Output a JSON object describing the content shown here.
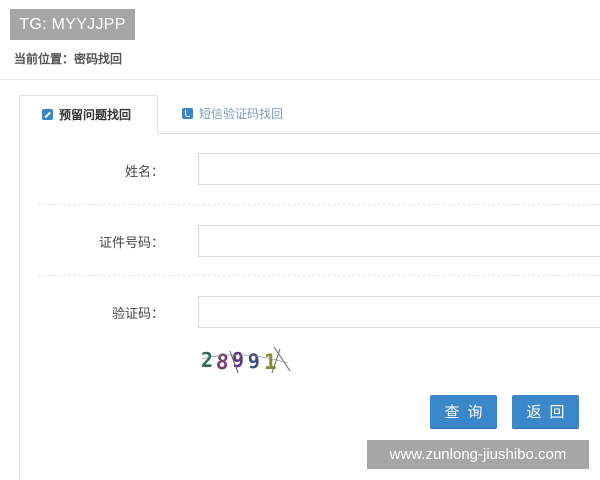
{
  "overlay": {
    "tg_label": "TG: MYYJJPP",
    "watermark_url": "www.zunlong-jiushibo.com"
  },
  "breadcrumb": {
    "text": "当前位置：密码找回"
  },
  "tabs": [
    {
      "label": "预留问题找回",
      "icon": "pencil-icon",
      "active": true
    },
    {
      "label": "短信验证码找回",
      "icon": "phone-icon",
      "active": false
    }
  ],
  "form": {
    "name": {
      "label": "姓名：",
      "value": "",
      "placeholder": ""
    },
    "id_number": {
      "label": "证件号码：",
      "value": "",
      "placeholder": ""
    },
    "captcha": {
      "label": "验证码：",
      "value": "",
      "placeholder": "",
      "image_text": "28991"
    }
  },
  "buttons": {
    "query": "查询",
    "back": "返回"
  },
  "colors": {
    "accent": "#3a87c9",
    "inactive_tab": "#7a9bbd",
    "overlay_gray": "#a6a6a6"
  }
}
